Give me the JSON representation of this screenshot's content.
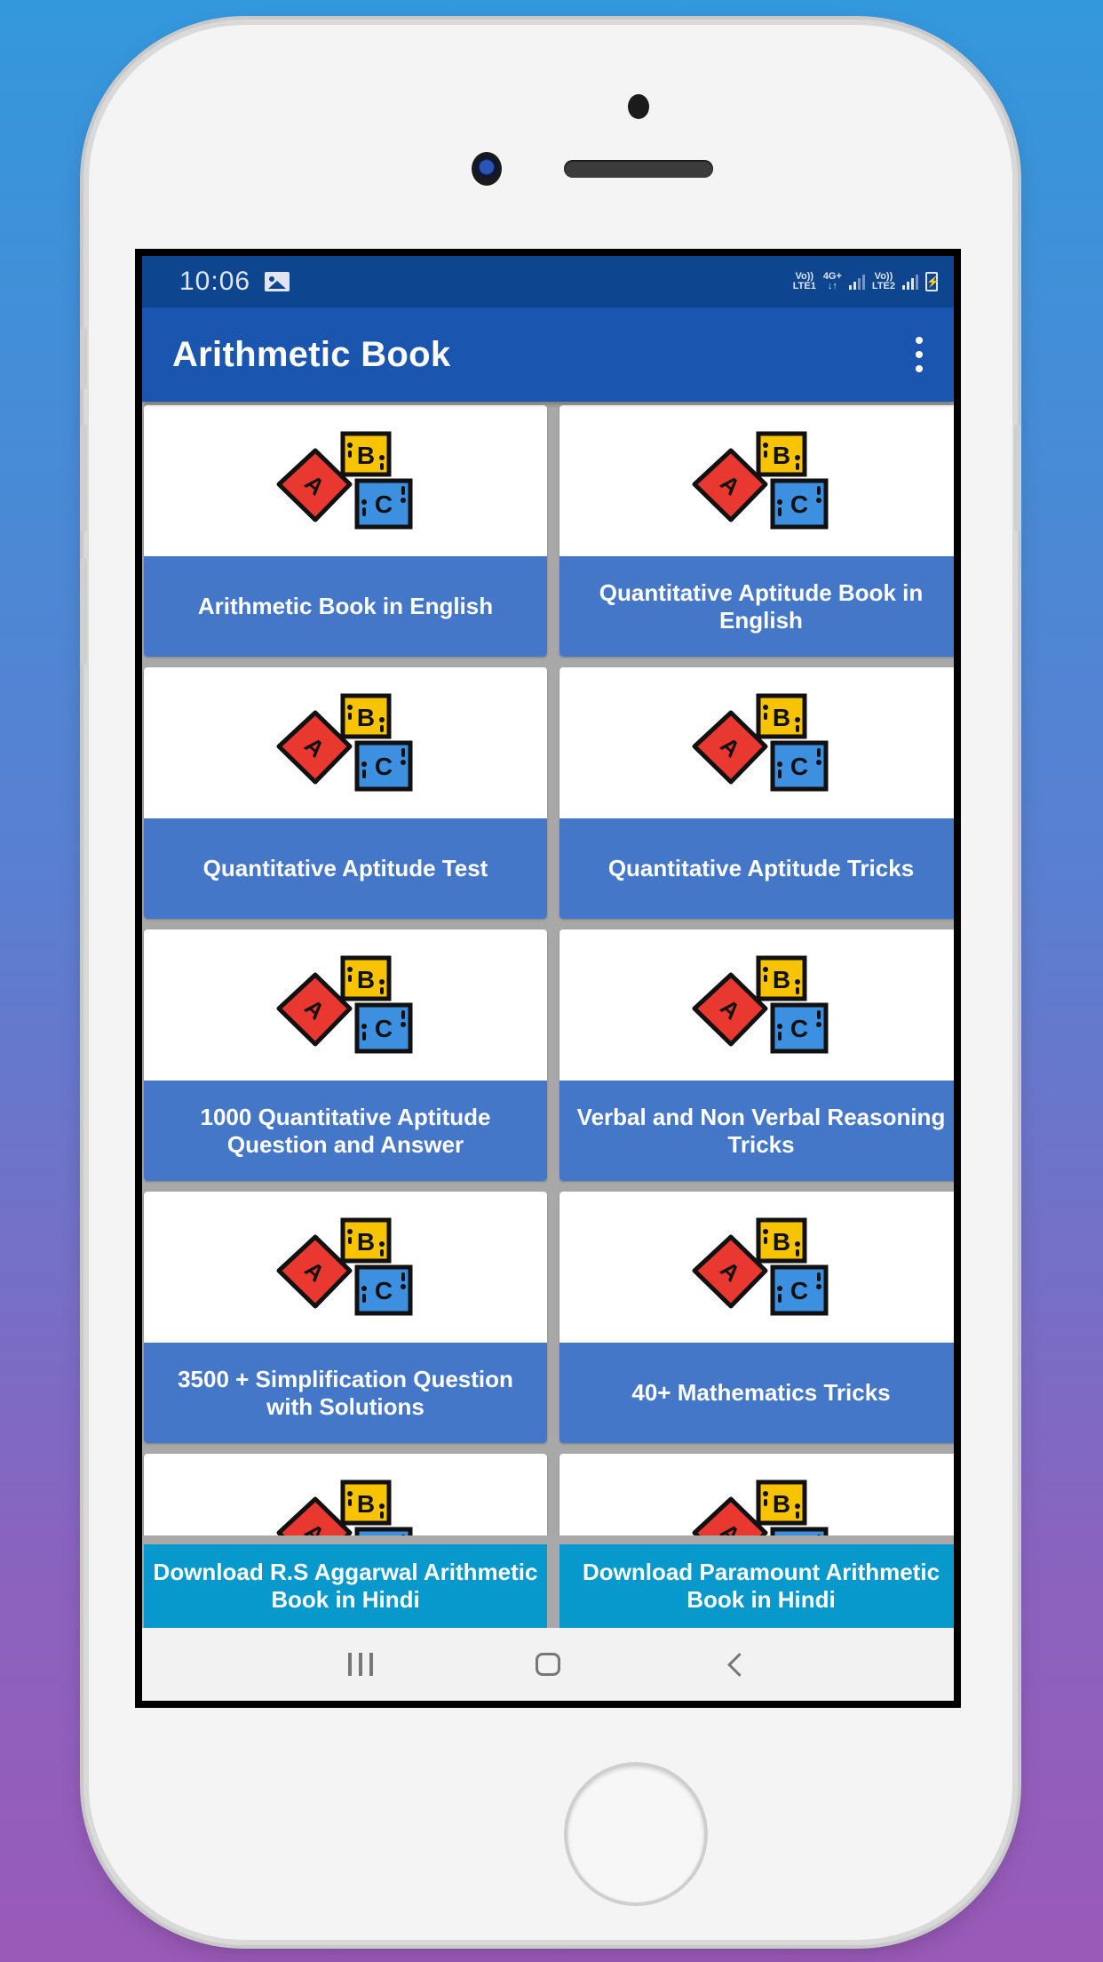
{
  "status_bar": {
    "time": "10:06",
    "notification_icon": "image-icon",
    "sim1_label_top": "Vo))",
    "sim1_label_bottom": "LTE1",
    "network_top": "4G+",
    "network_bottom": "↓↑",
    "sim2_label_top": "Vo))",
    "sim2_label_bottom": "LTE2",
    "battery_icon": "battery-charging-icon"
  },
  "app_bar": {
    "title": "Arithmetic Book",
    "menu_icon": "overflow-menu-icon"
  },
  "cards": [
    {
      "label": "Arithmetic Book in English",
      "icon": "abc-blocks-icon"
    },
    {
      "label": "Quantitative Aptitude Book in English",
      "icon": "abc-blocks-icon"
    },
    {
      "label": "Quantitative Aptitude Test",
      "icon": "abc-blocks-icon"
    },
    {
      "label": "Quantitative Aptitude Tricks",
      "icon": "abc-blocks-icon"
    },
    {
      "label": "1000 Quantitative Aptitude Question and Answer",
      "icon": "abc-blocks-icon"
    },
    {
      "label": "Verbal and Non Verbal Reasoning Tricks",
      "icon": "abc-blocks-icon"
    },
    {
      "label": "3500 + Simplification Question with Solutions",
      "icon": "abc-blocks-icon"
    },
    {
      "label": "40+ Mathematics Tricks",
      "icon": "abc-blocks-icon"
    },
    {
      "label": "",
      "icon": "abc-blocks-icon"
    },
    {
      "label": "",
      "icon": "abc-blocks-icon"
    }
  ],
  "bottom_buttons": [
    {
      "label": "Download R.S Aggarwal Arithmetic Book in Hindi"
    },
    {
      "label": "Download Paramount Arithmetic Book in Hindi"
    }
  ],
  "nav_bar": {
    "recents_icon": "recents-icon",
    "home_icon": "home-icon",
    "back_icon": "back-icon"
  },
  "colors": {
    "status_bar": "#0e458f",
    "app_bar": "#1a56b0",
    "card_label_bg": "#4577c9",
    "download_button_bg": "#0899cc",
    "block_a": "#e8382f",
    "block_b": "#f8c300",
    "block_c": "#3d8fe0"
  }
}
